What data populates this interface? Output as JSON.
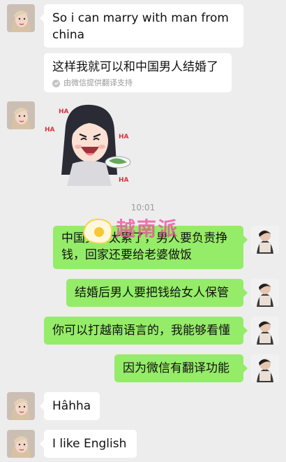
{
  "messages": [
    {
      "side": "left",
      "text": "So i can marry with man from china"
    },
    {
      "side": "left",
      "text": "这样我就可以和中国男人结婚了",
      "note": "由微信提供翻译支持"
    },
    {
      "side": "left",
      "sticker": "laughing-character-sticker",
      "sticker_text": "HA"
    },
    {
      "side": "right",
      "text": "中国男人太累了，男人要负责挣钱，回家还要给老婆做饭"
    },
    {
      "side": "right",
      "text": "结婚后男人要把钱给女人保管"
    },
    {
      "side": "right",
      "text": "你可以打越南语言的，我能够看懂"
    },
    {
      "side": "right",
      "text": "因为微信有翻译功能"
    },
    {
      "side": "left",
      "text": "Hâhha"
    },
    {
      "side": "left",
      "text": "I like English"
    }
  ],
  "timestamp": "10:01",
  "watermark": "越南派",
  "colors": {
    "background": "#ededed",
    "incoming": "#ffffff",
    "outgoing": "#95ec69",
    "watermark": "#ec4899"
  }
}
